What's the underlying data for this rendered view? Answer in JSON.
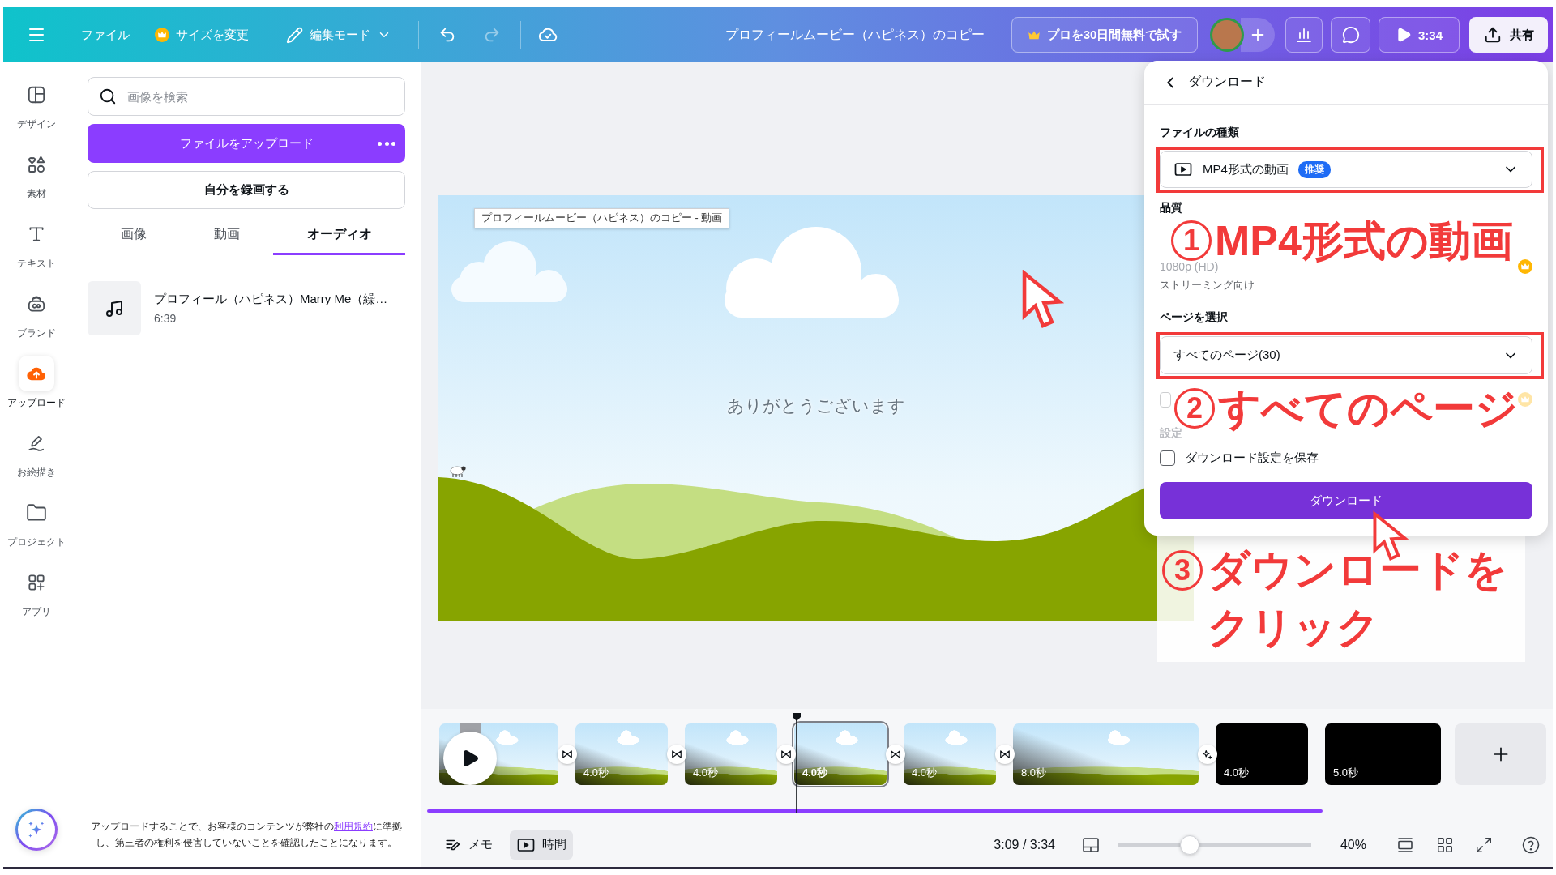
{
  "topbar": {
    "file_menu": "ファイル",
    "resize": "サイズを変更",
    "edit_mode": "編集モード",
    "history": [
      {
        "kind": "undo",
        "disabled": false
      },
      {
        "kind": "redo",
        "disabled": true
      }
    ],
    "title": "プロフィールムービー（ハピネス）のコピー",
    "pro_trial": "プロを30日間無料で試す",
    "play_duration": "3:34",
    "share": "共有"
  },
  "sidebar": {
    "items": [
      {
        "label": "デザイン",
        "selected": false
      },
      {
        "label": "素材",
        "selected": false
      },
      {
        "label": "テキスト",
        "selected": false
      },
      {
        "label": "ブランド",
        "selected": false
      },
      {
        "label": "アップロード",
        "selected": true
      },
      {
        "label": "お絵描き",
        "selected": false
      },
      {
        "label": "プロジェクト",
        "selected": false
      },
      {
        "label": "アプリ",
        "selected": false
      }
    ]
  },
  "upload_panel": {
    "search": {
      "placeholder": "画像を検索"
    },
    "upload_button": "ファイルをアップロード",
    "record_button": "自分を録画する",
    "tabs": [
      {
        "label": "画像",
        "selected": false
      },
      {
        "label": "動画",
        "selected": false
      },
      {
        "label": "オーディオ",
        "selected": true
      }
    ],
    "audio_items": [
      {
        "title": "プロフィール（ハピネス）Marry Me（繰…",
        "duration": "6:39"
      }
    ],
    "notice": {
      "before": "アップロードすることで、お客様のコンテンツが弊社の",
      "link": "利用規約",
      "after": "に準拠し、第三者の権利を侵害していないことを確認したことになります。"
    }
  },
  "canvas": {
    "tag": "プロフィールムービー（ハピネス）のコピー - 動画",
    "caption": "ありがとうございます"
  },
  "download_panel": {
    "title": "ダウンロード",
    "file_type_label": "ファイルの種類",
    "file_type": {
      "value": "MP4形式の動画",
      "badge": "推奨",
      "highlighted": true
    },
    "quality_label": "品質",
    "quality": "1080p (HD)",
    "quality_note": "ストリーミング向け",
    "pages_label": "ページを選択",
    "pages": {
      "value": "すべてのページ(30)",
      "highlighted": true
    },
    "covered_option": {
      "checked": false,
      "disabled": true
    },
    "settings_label": "設定",
    "save_settings": {
      "label": "ダウンロード設定を保存",
      "checked": false
    },
    "button": "ダウンロード"
  },
  "timeline": {
    "clips": [
      {
        "kind": "partial",
        "selected": false,
        "transition": {
          "kind": "bowtie"
        }
      },
      {
        "kind": "sky",
        "duration": "4.0秒",
        "selected": false,
        "transition": {
          "kind": "bowtie"
        }
      },
      {
        "kind": "sky",
        "duration": "4.0秒",
        "selected": false,
        "transition": {
          "kind": "bowtie"
        }
      },
      {
        "kind": "sky",
        "duration": "4.0秒",
        "selected": true,
        "transition": {
          "kind": "bowtie"
        }
      },
      {
        "kind": "sky",
        "duration": "4.0秒",
        "selected": false,
        "transition": {
          "kind": "bowtie"
        }
      },
      {
        "kind": "sky",
        "duration": "8.0秒",
        "selected": false,
        "transition": {
          "kind": "sparkle"
        }
      },
      {
        "kind": "black",
        "duration": "4.0秒",
        "selected": false
      },
      {
        "kind": "black",
        "duration": "5.0秒",
        "selected": false
      }
    ]
  },
  "bottom_bar": {
    "notes": {
      "label": "メモ",
      "selected": false
    },
    "timer": {
      "label": "時間",
      "selected": true
    },
    "time": "3:09 / 3:34",
    "zoom": {
      "level": 0.37,
      "reading": "40%"
    }
  },
  "annotations": [
    {
      "number": "1",
      "text": "MP4形式の動画"
    },
    {
      "number": "2",
      "text": "すべてのページ"
    },
    {
      "number": "3",
      "text": "ダウンロードをクリック"
    }
  ]
}
